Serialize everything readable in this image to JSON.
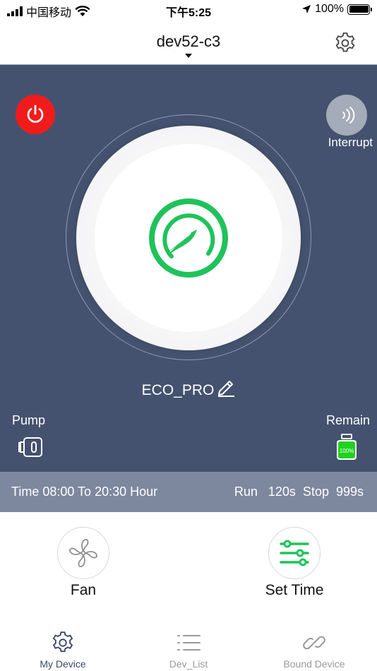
{
  "status_bar": {
    "carrier": "中国移动",
    "time": "下午5:25",
    "battery": "100%"
  },
  "header": {
    "device_name": "dev52-c3",
    "icons": [
      "chevron-down-icon",
      "gear-icon"
    ]
  },
  "controls": {
    "power_icon": "power-icon",
    "interrupt_label": "Interrupt",
    "mode_name": "ECO_PRO",
    "center_icon": "speedometer-icon",
    "pump_label": "Pump",
    "remain_label": "Remain",
    "remain_percent": "100%"
  },
  "schedule": {
    "text": "Time 08:00 To 20:30 Hour",
    "run_stop": "Run   120s  Stop  999s"
  },
  "actions": [
    {
      "label": "Fan",
      "icon": "fan-icon"
    },
    {
      "label": "Set Time",
      "icon": "sliders-icon"
    }
  ],
  "tabs": [
    {
      "label": "My Device",
      "icon": "gear-icon",
      "active": true
    },
    {
      "label": "Dev_List",
      "icon": "list-icon",
      "active": false
    },
    {
      "label": "Bound Device",
      "icon": "link-icon",
      "active": false
    }
  ],
  "colors": {
    "panel": "#44526f",
    "strip": "#7d889e",
    "power": "#f21b1b",
    "accent_green": "#1fc35a"
  }
}
